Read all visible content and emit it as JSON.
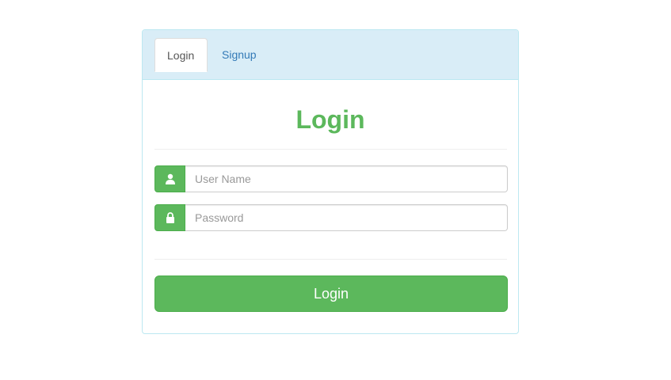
{
  "tabs": [
    {
      "label": "Login",
      "active": true
    },
    {
      "label": "Signup",
      "active": false
    }
  ],
  "form": {
    "title": "Login",
    "username": {
      "placeholder": "User Name",
      "value": "",
      "icon": "user-icon"
    },
    "password": {
      "placeholder": "Password",
      "value": "",
      "icon": "lock-icon"
    },
    "submit_label": "Login"
  },
  "colors": {
    "accent": "#5cb85c",
    "header_bg": "#d9edf7",
    "panel_border": "#bce8f1",
    "link": "#337ab7"
  }
}
